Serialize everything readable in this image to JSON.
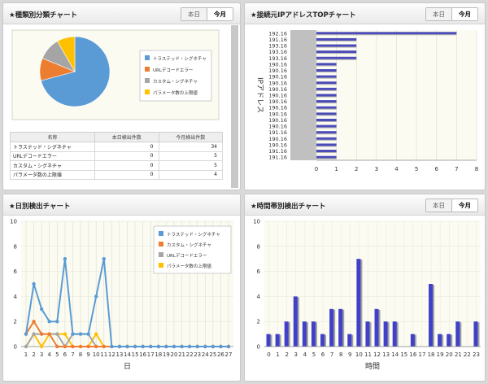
{
  "panels": {
    "category": {
      "title": "★種類別分類チャート",
      "tabs": [
        "本日",
        "今月"
      ],
      "legend": [
        "トラステッド・シグネチャ",
        "URLデコードエラー",
        "カスタム・シグネチャ",
        "パラメータ数の上限値"
      ],
      "table": {
        "headers": [
          "名称",
          "本日検出件数",
          "今月検出件数"
        ],
        "rows": [
          [
            "トラステッド・シグネチャ",
            "0",
            "34"
          ],
          [
            "URLデコードエラー",
            "0",
            "5"
          ],
          [
            "カスタム・シグネチャ",
            "0",
            "5"
          ],
          [
            "パラメータ数の上限値",
            "0",
            "4"
          ]
        ]
      }
    },
    "ip": {
      "title": "★接続元IPアドレスTOPチャート",
      "tabs": [
        "本日",
        "今月"
      ],
      "ylabel": "IPアドレス"
    },
    "daily": {
      "title": "★日別検出チャート",
      "xlabel": "日",
      "legend": [
        "トラステッド・シグネチャ",
        "カスタム・シグネチャ",
        "URLデコードエラー",
        "パラメータ数の上限値"
      ]
    },
    "hourly": {
      "title": "★時間帯別検出チャート",
      "tabs": [
        "本日",
        "今月"
      ],
      "xlabel": "時間"
    }
  },
  "colors": {
    "blue": "#5b9bd5",
    "orange": "#ed7d31",
    "gray": "#a5a5a5",
    "yellow": "#ffc000",
    "bar": "#4040c8",
    "bar_shadow": "#a0a0a0"
  },
  "chart_data": [
    {
      "type": "pie",
      "labels": [
        "トラステッド・シグネチャ",
        "URLデコードエラー",
        "カスタム・シグネチャ",
        "パラメータ数の上限値"
      ],
      "values": [
        34,
        5,
        5,
        4
      ],
      "legend": "right"
    },
    {
      "type": "bar",
      "orientation": "horizontal",
      "categories": [
        "192.16",
        "191.16",
        "193.16",
        "193.16",
        "193.16",
        "190.16",
        "190.16",
        "190.16",
        "190.16",
        "190.16",
        "190.16",
        "190.16",
        "190.16",
        "190.16",
        "190.16",
        "190.16",
        "191.16",
        "190.16",
        "190.16",
        "191.16",
        "191.16"
      ],
      "values": [
        7,
        2,
        2,
        2,
        2,
        1,
        1,
        1,
        1,
        1,
        1,
        1,
        1,
        1,
        1,
        1,
        1,
        1,
        1,
        1,
        1
      ],
      "xlim": [
        0,
        8
      ],
      "xticks": [
        0,
        1,
        2,
        3,
        4,
        5,
        6,
        7,
        8
      ],
      "ylabel": "IPアドレス"
    },
    {
      "type": "line",
      "x": [
        1,
        2,
        3,
        4,
        5,
        6,
        7,
        8,
        9,
        10,
        11,
        12,
        13,
        14,
        15,
        16,
        17,
        18,
        19,
        20,
        21,
        22,
        23,
        24,
        25,
        26,
        27
      ],
      "ylim": [
        0,
        10
      ],
      "yticks": [
        0,
        2,
        4,
        6,
        8,
        10
      ],
      "xlabel": "日",
      "legend": "top-right",
      "series": [
        {
          "name": "トラステッド・シグネチャ",
          "color": "#5b9bd5",
          "values": [
            1,
            5,
            3,
            2,
            2,
            7,
            1,
            1,
            1,
            4,
            7,
            0,
            0,
            0,
            0,
            0,
            0,
            0,
            0,
            0,
            0,
            0,
            0,
            0,
            0,
            0,
            0
          ]
        },
        {
          "name": "カスタム・シグネチャ",
          "color": "#ed7d31",
          "values": [
            1,
            2,
            1,
            1,
            0,
            0,
            0,
            0,
            0,
            0,
            0,
            0,
            0,
            0,
            0,
            0,
            0,
            0,
            0,
            0,
            0,
            0,
            0,
            0,
            0,
            0,
            0
          ]
        },
        {
          "name": "URLデコードエラー",
          "color": "#a5a5a5",
          "values": [
            0,
            1,
            1,
            1,
            1,
            0,
            1,
            1,
            1,
            0,
            0,
            0,
            0,
            0,
            0,
            0,
            0,
            0,
            0,
            0,
            0,
            0,
            0,
            0,
            0,
            0,
            0
          ]
        },
        {
          "name": "パラメータ数の上限値",
          "color": "#ffc000",
          "values": [
            0,
            1,
            0,
            1,
            1,
            1,
            0,
            0,
            0,
            1,
            0,
            0,
            0,
            0,
            0,
            0,
            0,
            0,
            0,
            0,
            0,
            0,
            0,
            0,
            0,
            0,
            0
          ]
        }
      ]
    },
    {
      "type": "bar",
      "categories": [
        "0",
        "1",
        "2",
        "3",
        "4",
        "5",
        "6",
        "7",
        "8",
        "9",
        "10",
        "11",
        "12",
        "13",
        "14",
        "15",
        "16",
        "17",
        "18",
        "19",
        "20",
        "21",
        "22",
        "23"
      ],
      "values": [
        1,
        1,
        2,
        4,
        2,
        2,
        1,
        3,
        3,
        1,
        7,
        2,
        3,
        2,
        2,
        0,
        1,
        0,
        5,
        1,
        1,
        2,
        0,
        2
      ],
      "ylim": [
        0,
        10
      ],
      "yticks": [
        0,
        2,
        4,
        6,
        8,
        10
      ],
      "xlabel": "時間"
    }
  ]
}
